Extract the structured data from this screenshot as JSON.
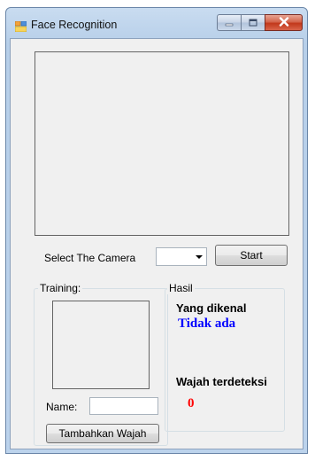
{
  "window": {
    "title": "Face Recognition",
    "icon": "form-icon"
  },
  "camera": {
    "select_label": "Select The Camera",
    "selected_value": "",
    "start_label": "Start"
  },
  "training": {
    "legend": "Training:",
    "name_label": "Name:",
    "name_value": "",
    "add_face_label": "Tambahkan Wajah"
  },
  "result": {
    "legend": "Hasil",
    "recognized_label": "Yang dikenal",
    "recognized_value": "Tidak ada",
    "detected_label": "Wajah terdeteksi",
    "detected_count": "0"
  },
  "colors": {
    "recognized_value": "#0000ff",
    "detected_count": "#ff0000"
  }
}
